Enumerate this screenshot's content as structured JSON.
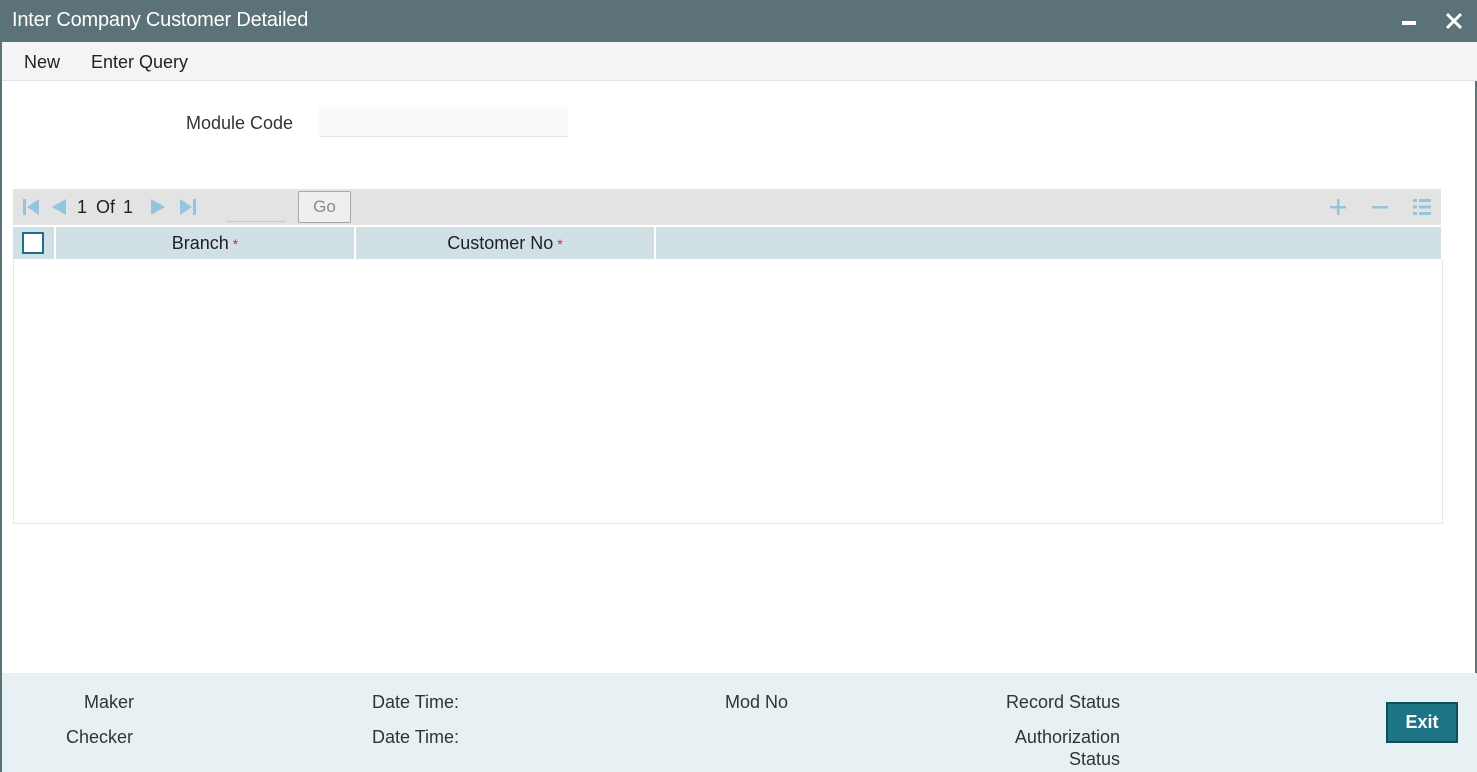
{
  "window": {
    "title": "Inter Company Customer Detailed",
    "minimize_icon": "minimize-icon",
    "close_icon": "close-icon"
  },
  "menu": {
    "new_label": "New",
    "enter_query_label": "Enter Query"
  },
  "form": {
    "module_code_label": "Module Code",
    "module_code_value": ""
  },
  "grid": {
    "pagination": {
      "current": "1",
      "of_label": "Of",
      "total": "1",
      "go_label": "Go",
      "page_input_value": ""
    },
    "icons": [
      "first-page-icon",
      "prev-page-icon",
      "next-page-icon",
      "last-page-icon",
      "add-row-icon",
      "delete-row-icon",
      "list-view-icon"
    ],
    "columns": [
      {
        "label": "Branch",
        "required": "*"
      },
      {
        "label": "Customer No",
        "required": "*"
      }
    ],
    "rows": []
  },
  "footer": {
    "maker_label": "Maker",
    "checker_label": "Checker",
    "date_time_label_1": "Date Time:",
    "date_time_label_2": "Date Time:",
    "mod_no_label": "Mod No",
    "record_status_label": "Record Status",
    "authorization_label": "Authorization",
    "status_label": "Status",
    "exit_label": "Exit"
  },
  "colors": {
    "titlebar": "#5a7278",
    "grid_header": "#d1e0e4",
    "footer": "#e7f0f3",
    "exit_button": "#1d7484",
    "icon": "#93c5de",
    "required": "#e02020"
  }
}
